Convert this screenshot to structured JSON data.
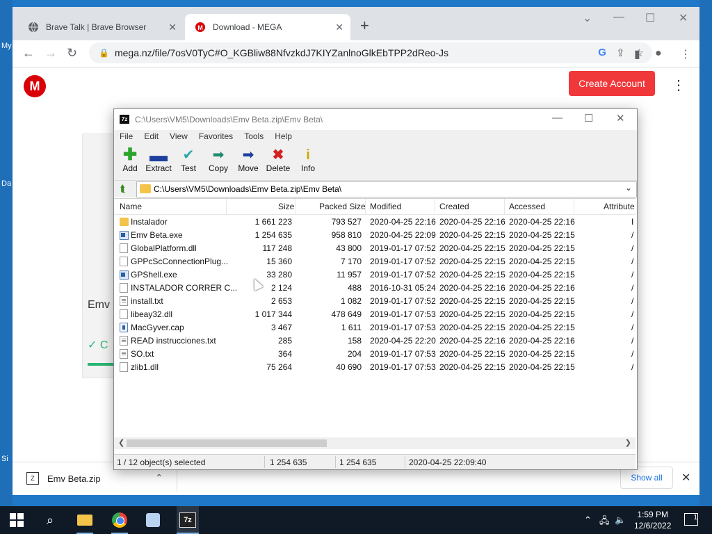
{
  "desktop": {
    "left_labels": [
      "My",
      "Da",
      "Si"
    ]
  },
  "browser": {
    "tabs": [
      {
        "title": "Brave Talk | Brave Browser",
        "active": false
      },
      {
        "title": "Download - MEGA",
        "active": true
      }
    ],
    "new_tab_label": "+",
    "url": "mega.nz/file/7osV0TyC#O_KGBliw88NfvzkdJ7KIYZanlnoGlkEbTPP2dReo-Js",
    "page": {
      "create_account": "Create Account",
      "logo_letter": "M",
      "filename_partial": "Emv B",
      "status_partial": "C"
    },
    "download_shelf": {
      "filename": "Emv Beta.zip",
      "show_all": "Show all"
    }
  },
  "sevenzip": {
    "title": "C:\\Users\\VM5\\Downloads\\Emv Beta.zip\\Emv Beta\\",
    "icon_text": "7z",
    "menu": [
      "File",
      "Edit",
      "View",
      "Favorites",
      "Tools",
      "Help"
    ],
    "toolbar": [
      {
        "label": "Add",
        "icon": "add-icon",
        "color": "#2aa52a"
      },
      {
        "label": "Extract",
        "icon": "extract-icon",
        "color": "#1c3f9e"
      },
      {
        "label": "Test",
        "icon": "test-icon",
        "color": "#29a8a8"
      },
      {
        "label": "Copy",
        "icon": "copy-icon",
        "color": "#1f8a6e"
      },
      {
        "label": "Move",
        "icon": "move-icon",
        "color": "#1c3f9e"
      },
      {
        "label": "Delete",
        "icon": "delete-icon",
        "color": "#d61f1f"
      },
      {
        "label": "Info",
        "icon": "info-icon",
        "color": "#c9a800"
      }
    ],
    "address": "C:\\Users\\VM5\\Downloads\\Emv Beta.zip\\Emv Beta\\",
    "columns": [
      "Name",
      "Size",
      "Packed Size",
      "Modified",
      "Created",
      "Accessed",
      "Attribute"
    ],
    "files": [
      {
        "type": "folder",
        "name": "Instalador",
        "size": "1 661 223",
        "packed": "793 527",
        "modified": "2020-04-25 22:16",
        "created": "2020-04-25 22:16",
        "accessed": "2020-04-25 22:16",
        "attr": "I"
      },
      {
        "type": "exe",
        "name": "Emv Beta.exe",
        "size": "1 254 635",
        "packed": "958 810",
        "modified": "2020-04-25 22:09",
        "created": "2020-04-25 22:15",
        "accessed": "2020-04-25 22:15",
        "attr": "/"
      },
      {
        "type": "dll",
        "name": "GlobalPlatform.dll",
        "size": "117 248",
        "packed": "43 800",
        "modified": "2019-01-17 07:52",
        "created": "2020-04-25 22:15",
        "accessed": "2020-04-25 22:15",
        "attr": "/"
      },
      {
        "type": "dll",
        "name": "GPPcScConnectionPlug...",
        "size": "15 360",
        "packed": "7 170",
        "modified": "2019-01-17 07:52",
        "created": "2020-04-25 22:15",
        "accessed": "2020-04-25 22:15",
        "attr": "/"
      },
      {
        "type": "exe",
        "name": "GPShell.exe",
        "size": "33 280",
        "packed": "11 957",
        "modified": "2019-01-17 07:52",
        "created": "2020-04-25 22:15",
        "accessed": "2020-04-25 22:15",
        "attr": "/"
      },
      {
        "type": "dll",
        "name": "INSTALADOR CORRER C...",
        "size": "2 124",
        "packed": "488",
        "modified": "2016-10-31 05:24",
        "created": "2020-04-25 22:16",
        "accessed": "2020-04-25 22:16",
        "attr": "/"
      },
      {
        "type": "txt",
        "name": "install.txt",
        "size": "2 653",
        "packed": "1 082",
        "modified": "2019-01-17 07:52",
        "created": "2020-04-25 22:15",
        "accessed": "2020-04-25 22:15",
        "attr": "/"
      },
      {
        "type": "dll",
        "name": "libeay32.dll",
        "size": "1 017 344",
        "packed": "478 649",
        "modified": "2019-01-17 07:53",
        "created": "2020-04-25 22:15",
        "accessed": "2020-04-25 22:15",
        "attr": "/"
      },
      {
        "type": "cap",
        "name": "MacGyver.cap",
        "size": "3 467",
        "packed": "1 611",
        "modified": "2019-01-17 07:53",
        "created": "2020-04-25 22:15",
        "accessed": "2020-04-25 22:15",
        "attr": "/"
      },
      {
        "type": "txt",
        "name": "READ instrucciones.txt",
        "size": "285",
        "packed": "158",
        "modified": "2020-04-25 22:20",
        "created": "2020-04-25 22:16",
        "accessed": "2020-04-25 22:16",
        "attr": "/"
      },
      {
        "type": "txt",
        "name": "SO.txt",
        "size": "364",
        "packed": "204",
        "modified": "2019-01-17 07:53",
        "created": "2020-04-25 22:15",
        "accessed": "2020-04-25 22:15",
        "attr": "/"
      },
      {
        "type": "dll",
        "name": "zlib1.dll",
        "size": "75 264",
        "packed": "40 690",
        "modified": "2019-01-17 07:53",
        "created": "2020-04-25 22:15",
        "accessed": "2020-04-25 22:15",
        "attr": "/"
      }
    ],
    "status": {
      "selection": "1 / 12 object(s) selected",
      "size": "1 254 635",
      "packed": "1 254 635",
      "modified": "2020-04-25 22:09:40"
    }
  },
  "taskbar": {
    "time": "1:59 PM",
    "date": "12/6/2022",
    "notifications": "1"
  }
}
